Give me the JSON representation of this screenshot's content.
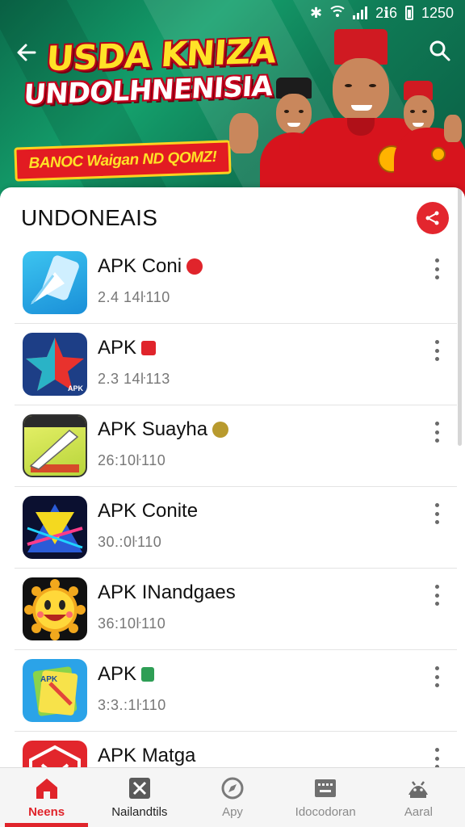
{
  "status_bar": {
    "network": "2ℹ6",
    "time": "1250"
  },
  "banner": {
    "headline_line1": "USDA KNIZA",
    "headline_line2": "UNDOLHNENISIA",
    "tagline": "BANOC Waigan ND QOMZ!"
  },
  "section": {
    "title": "UNDONEAIS"
  },
  "apps": [
    {
      "name": "APK Coni",
      "size": "2.4 14ŀ110",
      "badge_color": "#e0242b"
    },
    {
      "name": "APK",
      "size": "2.3 14ŀ113",
      "badge_color": "#e0242b"
    },
    {
      "name": "APK Suayha",
      "size": "26:10ŀ110",
      "badge_color": "#b89a2e"
    },
    {
      "name": "APK Conite",
      "size": "30.:0ŀ110",
      "badge_color": ""
    },
    {
      "name": "APK INandgaes",
      "size": "36:10ŀ110",
      "badge_color": ""
    },
    {
      "name": "APK",
      "size": "3:3.:1ŀ110",
      "badge_color": "#2e9e55"
    },
    {
      "name": "APK Matga",
      "size": "",
      "badge_color": ""
    }
  ],
  "bottom_nav": [
    {
      "label": "Neens",
      "icon": "home-icon",
      "active": true
    },
    {
      "label": "Nailandtils",
      "icon": "close-box-icon",
      "active": false
    },
    {
      "label": "Apy",
      "icon": "compass-icon",
      "active": false
    },
    {
      "label": "Idocodoran",
      "icon": "keyboard-icon",
      "active": false
    },
    {
      "label": "Aaral",
      "icon": "android-icon",
      "active": false
    }
  ],
  "colors": {
    "accent": "#e0242b",
    "banner_green": "#14a06c",
    "headline_yellow": "#ffe227"
  }
}
